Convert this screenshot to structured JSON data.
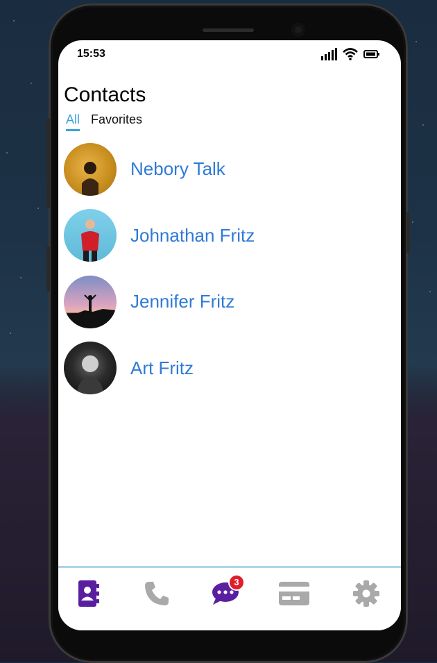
{
  "status_bar": {
    "time": "15:53"
  },
  "page": {
    "title": "Contacts"
  },
  "tabs": [
    {
      "label": "All",
      "active": true
    },
    {
      "label": "Favorites",
      "active": false
    }
  ],
  "contacts": [
    {
      "name": "Nebory Talk"
    },
    {
      "name": "Johnathan Fritz"
    },
    {
      "name": "Jennifer Fritz"
    },
    {
      "name": "Art Fritz"
    }
  ],
  "bottom_nav": {
    "items": [
      {
        "icon": "contacts-book-icon",
        "active": true
      },
      {
        "icon": "phone-icon",
        "active": false
      },
      {
        "icon": "chat-bubble-icon",
        "active": true,
        "badge": "3"
      },
      {
        "icon": "card-icon",
        "active": false
      },
      {
        "icon": "gear-icon",
        "active": false
      }
    ]
  },
  "colors": {
    "accent_tab": "#3aa2d8",
    "contact_name": "#2f7ad6",
    "nav_active": "#5a1fa0",
    "nav_inactive": "#a9a9a9",
    "badge": "#e01e2a"
  }
}
